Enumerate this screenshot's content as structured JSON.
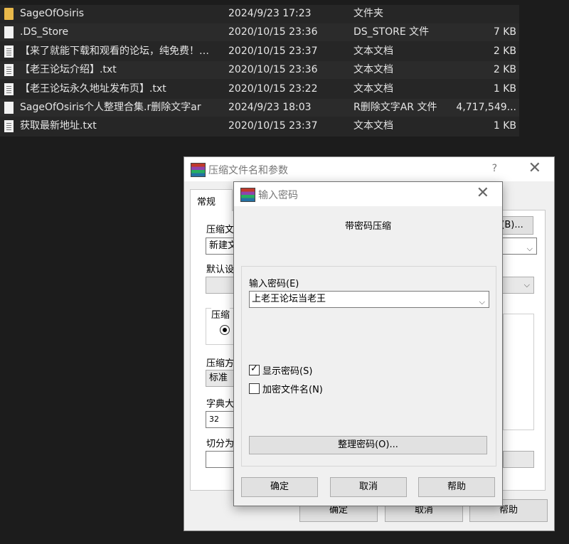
{
  "files": [
    {
      "name": "SageOfOsiris",
      "date": "2024/9/23 17:23",
      "type": "文件夹",
      "size": "",
      "icon": "folder-icon"
    },
    {
      "name": ".DS_Store",
      "date": "2020/10/15 23:36",
      "type": "DS_STORE 文件",
      "size": "7 KB",
      "icon": "file-icon"
    },
    {
      "name": "【来了就能下载和观看的论坛，纯免费！…",
      "date": "2020/10/15 23:37",
      "type": "文本文档",
      "size": "2 KB",
      "icon": "text-file-icon"
    },
    {
      "name": "【老王论坛介绍】.txt",
      "date": "2020/10/15 23:36",
      "type": "文本文档",
      "size": "2 KB",
      "icon": "text-file-icon"
    },
    {
      "name": "【老王论坛永久地址发布页】.txt",
      "date": "2020/10/15 23:22",
      "type": "文本文档",
      "size": "1 KB",
      "icon": "text-file-icon"
    },
    {
      "name": "SageOfOsiris个人整理合集.r删除文字ar",
      "date": "2024/9/23 18:03",
      "type": "R删除文字AR 文件",
      "size": "4,717,549...",
      "icon": "file-icon"
    },
    {
      "name": "获取最新地址.txt",
      "date": "2020/10/15 23:37",
      "type": "文本文档",
      "size": "1 KB",
      "icon": "text-file-icon"
    }
  ],
  "archive_dialog": {
    "title": "压缩文件名和参数",
    "help": "?",
    "close": "✕",
    "tab_general": "常规",
    "archive_name_label": "压缩文",
    "browse_button": "(B)...",
    "archive_name_value": "新建文",
    "default_profile_label": "默认设",
    "format_group_label": "压缩",
    "method_label": "压缩方",
    "method_value": "标准",
    "dict_label": "字典大",
    "dict_value": "32",
    "split_label": "切分为",
    "right_hint": ")",
    "ok": "确定",
    "cancel": "取消",
    "help_button": "帮助"
  },
  "password_dialog": {
    "title": "输入密码",
    "close": "✕",
    "heading": "带密码压缩",
    "password_label": "输入密码(E)",
    "password_value": "上老王论坛当老王",
    "show_password": "显示密码(S)",
    "show_password_checked": true,
    "encrypt_names": "加密文件名(N)",
    "encrypt_names_checked": false,
    "organize_button": "整理密码(O)...",
    "ok": "确定",
    "cancel": "取消",
    "help_button": "帮助"
  }
}
